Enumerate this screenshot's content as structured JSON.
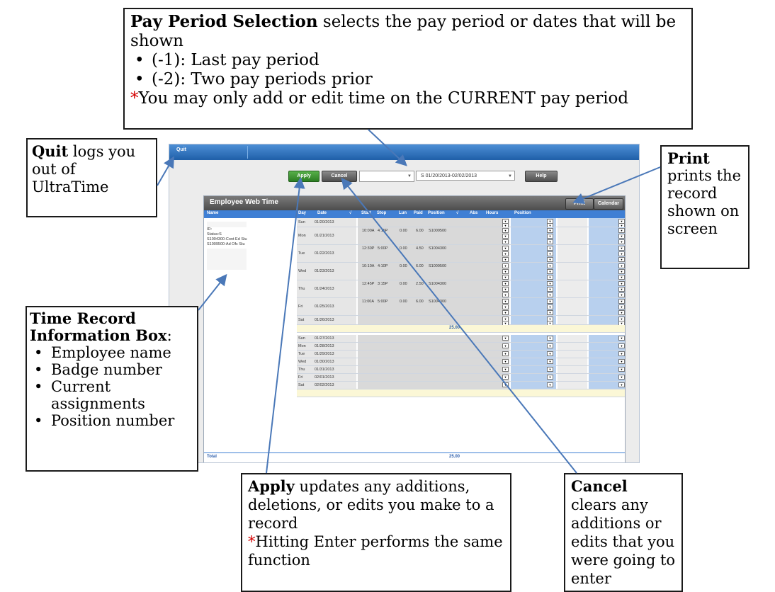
{
  "app": {
    "quit_label": "Quit",
    "apply_label": "Apply",
    "cancel_label": "Cancel",
    "help_label": "Help",
    "pay_period_value": "S 01/20/2013-02/02/2013",
    "panel_title": "Employee Web Time",
    "print_label": "Print",
    "calendar_label": "Calendar",
    "columns": [
      "Name",
      "Day",
      "Date",
      "√",
      "Start",
      "Stop",
      "Lun",
      "Paid",
      "Position",
      "√",
      "Abs",
      "Hours",
      "Position"
    ],
    "info_lines": [
      "ID:",
      "Status:S",
      "S1004300-Cont Ed Stu",
      "S1009500-Ad Ofc Stu"
    ],
    "week1": [
      {
        "day": "Sun",
        "date": "01/20/2013",
        "start": "",
        "stop": "",
        "lun": "",
        "paid": "",
        "pos": ""
      },
      {
        "day": "Mon",
        "date": "01/21/2013",
        "start": "10:00A",
        "stop": "4:15P",
        "lun": "0.00",
        "paid": "6.00",
        "pos": "S1009500"
      },
      {
        "day": "Tue",
        "date": "01/22/2013",
        "start": "12:30P",
        "stop": "5:00P",
        "lun": "0.00",
        "paid": "4.50",
        "pos": "S1004300"
      },
      {
        "day": "Wed",
        "date": "01/23/2013",
        "start": "10:10A",
        "stop": "4:10P",
        "lun": "0.00",
        "paid": "6.00",
        "pos": "S1009500"
      },
      {
        "day": "Thu",
        "date": "01/24/2013",
        "start": "12:45P",
        "stop": "3:15P",
        "lun": "0.00",
        "paid": "2.50",
        "pos": "S1004300"
      },
      {
        "day": "Fri",
        "date": "01/25/2013",
        "start": "11:00A",
        "stop": "5:00P",
        "lun": "0.00",
        "paid": "6.00",
        "pos": "S1004300"
      },
      {
        "day": "Sat",
        "date": "01/26/2013",
        "start": "",
        "stop": "",
        "lun": "",
        "paid": "",
        "pos": ""
      }
    ],
    "week1_total": "25.00",
    "week2": [
      {
        "day": "Sun",
        "date": "01/27/2013"
      },
      {
        "day": "Mon",
        "date": "01/28/2013"
      },
      {
        "day": "Tue",
        "date": "01/29/2013"
      },
      {
        "day": "Wed",
        "date": "01/30/2013"
      },
      {
        "day": "Thu",
        "date": "01/31/2013"
      },
      {
        "day": "Fri",
        "date": "02/01/2013"
      },
      {
        "day": "Sat",
        "date": "02/02/2013"
      }
    ],
    "total_label": "Total",
    "grand_total": "25.00"
  },
  "callouts": {
    "pay_period": {
      "title": "Pay Period Selection",
      "text": " selects the pay period or dates that will be shown",
      "bullets": [
        "(-1): Last pay period",
        "(-2): Two pay periods prior"
      ],
      "star": "*",
      "note": "You may only add or  edit time on the CURRENT pay period"
    },
    "quit": {
      "title": "Quit",
      "text": " logs you out of UltraTime"
    },
    "print": {
      "title": "Print",
      "text": "prints the record shown on screen"
    },
    "time_record": {
      "title": "Time Record Information Box",
      "colon": ":",
      "bullets": [
        "Employee name",
        "Badge number",
        "Current assignments",
        "Position number"
      ]
    },
    "apply": {
      "title": "Apply",
      "text": " updates any additions, deletions, or edits you make to a record",
      "star": "*",
      "note": "Hitting Enter performs the same function"
    },
    "cancel": {
      "title": "Cancel",
      "text": " clears any additions or edits that you were going to enter"
    }
  }
}
